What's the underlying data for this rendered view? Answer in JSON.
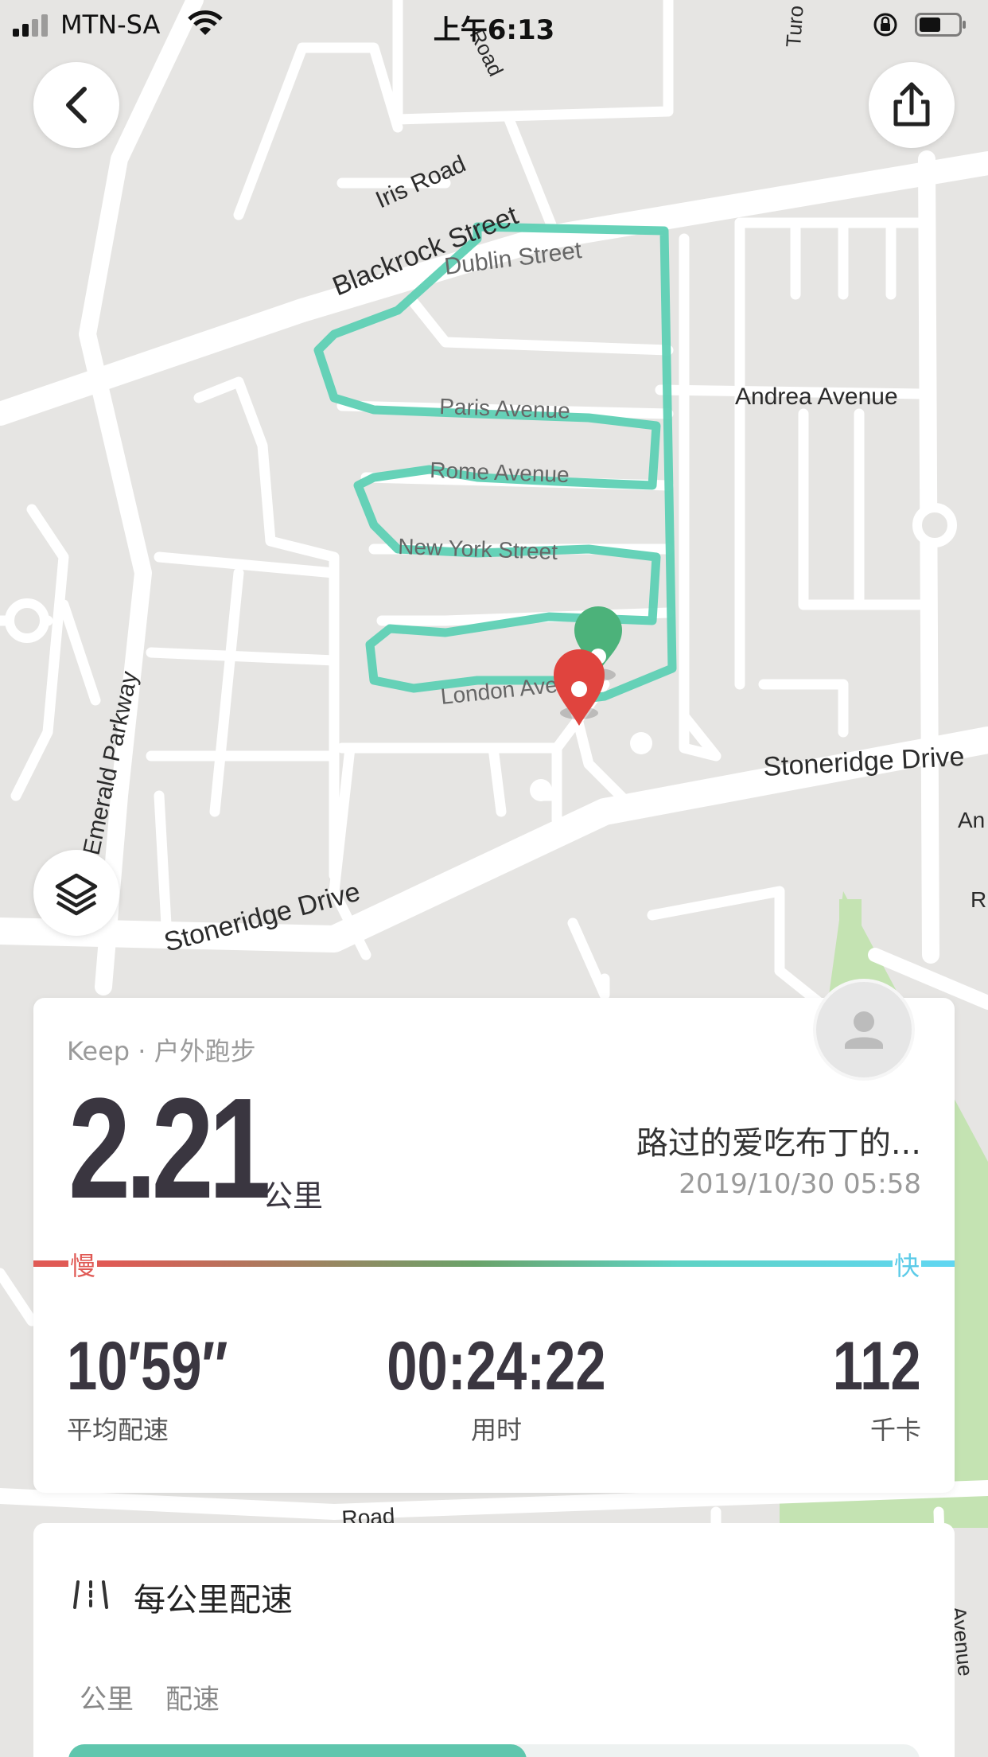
{
  "status_bar": {
    "carrier": "MTN-SA",
    "time": "上午6:13"
  },
  "map": {
    "street_labels": {
      "iris_road": "Iris Road",
      "blackrock_street": "Blackrock Street",
      "dublin_street": "Dublin Street",
      "paris_avenue": "Paris Avenue",
      "rome_avenue": "Rome Avenue",
      "new_york_street": "New York Street",
      "london_avenue": "London Avenue",
      "andrea_avenue": "Andrea Avenue",
      "stoneridge_drive_right": "Stoneridge Drive",
      "stoneridge_drive_left": "Stoneridge Drive",
      "emerald_parkway": "Emerald Parkway",
      "road_bottom": "Road",
      "road_top": "Road",
      "turo": "Turo",
      "an_label": "An",
      "r_label": "R",
      "avenue_bottom": "Avenue"
    },
    "route_color": "#5ed0b4",
    "start_pin_color": "#4cb27a",
    "end_pin_color": "#e0443e"
  },
  "buttons": {
    "back_icon": "chevron-left-icon",
    "share_icon": "share-icon",
    "layers_icon": "layers-icon"
  },
  "summary": {
    "source": "Keep · 户外跑步",
    "distance": "2.21",
    "distance_unit": "公里",
    "user_name": "路过的爱吃布丁的...",
    "datetime": "2019/10/30 05:58",
    "pace_slow_label": "慢",
    "pace_fast_label": "快",
    "avg_pace_value": "10′59″",
    "avg_pace_label": "平均配速",
    "duration_value": "00:24:22",
    "duration_label": "用时",
    "calories_value": "112",
    "calories_label": "千卡"
  },
  "splits": {
    "title": "每公里配速",
    "col_km": "公里",
    "col_pace": "配速"
  }
}
